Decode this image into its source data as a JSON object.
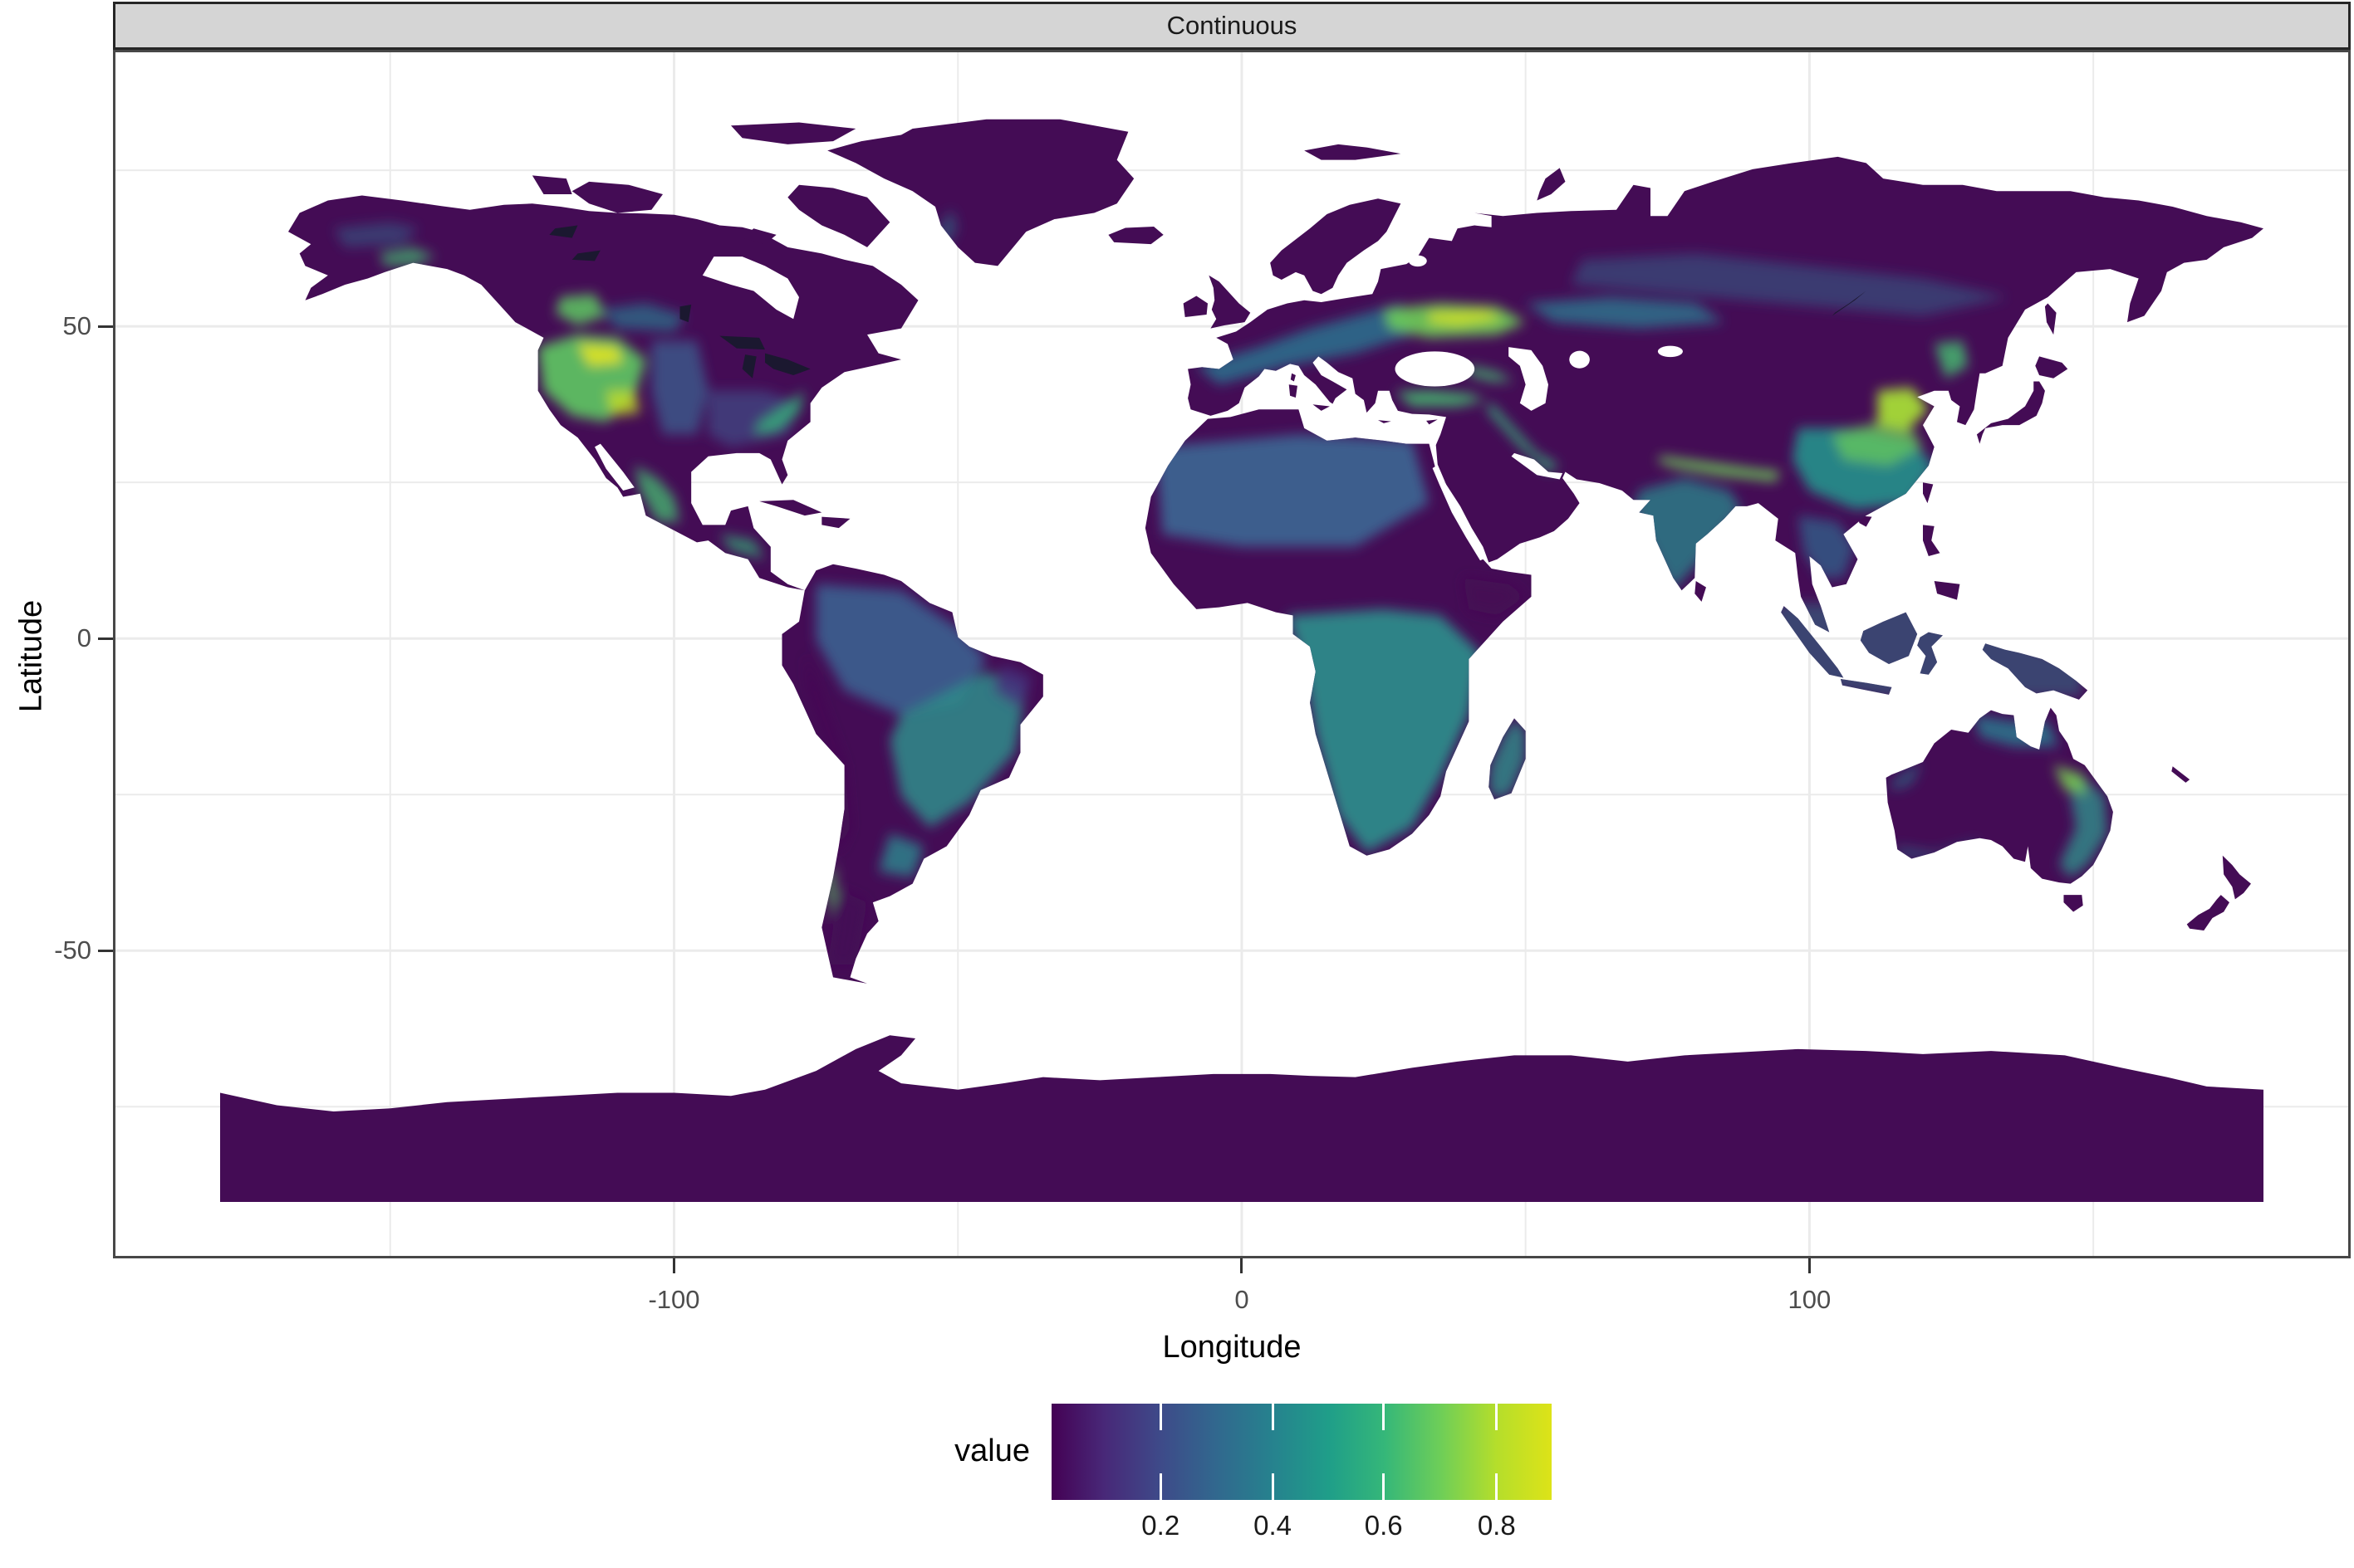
{
  "strip": {
    "title": "Continuous"
  },
  "axes": {
    "x": {
      "title": "Longitude",
      "breaks": [
        -100,
        0,
        100
      ],
      "labels": [
        "-100",
        "0",
        "100"
      ],
      "minor_breaks": [
        -150,
        -50,
        50,
        150
      ]
    },
    "y": {
      "title": "Latitude",
      "breaks": [
        50,
        0,
        -50
      ],
      "labels": [
        "50",
        "0",
        "-50"
      ],
      "minor_breaks": [
        75,
        25,
        -25,
        -75
      ]
    }
  },
  "legend": {
    "title": "value",
    "ticks": [
      "0.2",
      "0.4",
      "0.6",
      "0.8"
    ],
    "tick_fractions": [
      0.218,
      0.442,
      0.664,
      0.89
    ],
    "limits": [
      0.01,
      0.9
    ]
  },
  "colors": {
    "strip_bg": "#d5d5d5",
    "strip_border": "#262626",
    "panel_border": "#474747",
    "grid": "#ebebeb",
    "axis_text": "#4d4d4d",
    "text": "#000000",
    "land_low": "#440c55",
    "lake": "#1b1830",
    "viridis_stops": [
      [
        0.0,
        "#440154"
      ],
      [
        0.105,
        "#482878"
      ],
      [
        0.217,
        "#3e4a89"
      ],
      [
        0.33,
        "#31688e"
      ],
      [
        0.442,
        "#26828e"
      ],
      [
        0.554,
        "#1f9e89"
      ],
      [
        0.666,
        "#35b779"
      ],
      [
        0.778,
        "#6ece58"
      ],
      [
        0.89,
        "#b5de2b"
      ],
      [
        1.0,
        "#dde318"
      ]
    ]
  },
  "chart_data": {
    "type": "heatmap",
    "subtype": "global-raster-map",
    "title": "Continuous",
    "xlabel": "Longitude",
    "ylabel": "Latitude",
    "x_range": [
      -180,
      180
    ],
    "y_range": [
      -90,
      84
    ],
    "x_ticks": [
      -100,
      0,
      100
    ],
    "y_ticks": [
      -50,
      0,
      50
    ],
    "grid": true,
    "projection": "equirectangular",
    "legend": {
      "title": "value",
      "position": "bottom",
      "ticks": [
        0.2,
        0.4,
        0.6,
        0.8
      ],
      "limits_shown": [
        0.0,
        0.9
      ]
    },
    "palette": {
      "name": "viridis",
      "low": "#440154",
      "high": "#fde725"
    },
    "ocean": "no data (white)",
    "regions": [
      {
        "region": "Arctic Canada / boreal shield",
        "approx_value": 0.05
      },
      {
        "region": "Greenland",
        "approx_value": 0.05
      },
      {
        "region": "Antarctica",
        "approx_value": 0.05
      },
      {
        "region": "Western US mountain ranges (Rockies, Sierra, Cascades)",
        "approx_value": 0.75
      },
      {
        "region": "Idaho / Montana northern Rockies",
        "approx_value": 0.9
      },
      {
        "region": "Great Plains (US)",
        "approx_value": 0.3
      },
      {
        "region": "Eastern US lowlands",
        "approx_value": 0.3
      },
      {
        "region": "Appalachians",
        "approx_value": 0.6
      },
      {
        "region": "Sierra Madre (Mexico)",
        "approx_value": 0.6
      },
      {
        "region": "Amazon basin",
        "approx_value": 0.35
      },
      {
        "region": "Brazilian highlands / SE South America",
        "approx_value": 0.5
      },
      {
        "region": "Andes ridge",
        "approx_value": 0.1
      },
      {
        "region": "Patagonia",
        "approx_value": 0.1
      },
      {
        "region": "Sahara (northern Africa)",
        "approx_value": 0.3
      },
      {
        "region": "Sahel belt",
        "approx_value": 0.1
      },
      {
        "region": "Central & southern Africa",
        "approx_value": 0.5
      },
      {
        "region": "Horn of Africa",
        "approx_value": 0.1
      },
      {
        "region": "Western / central Europe",
        "approx_value": 0.45
      },
      {
        "region": "Ukraine / southern Russia belt",
        "approx_value": 0.85
      },
      {
        "region": "Anatolia (Turkey)",
        "approx_value": 0.7
      },
      {
        "region": "Caucasus and Zagros ridges",
        "approx_value": 0.7
      },
      {
        "region": "Central Asian steppe",
        "approx_value": 0.5
      },
      {
        "region": "Tibetan Plateau",
        "approx_value": 0.08
      },
      {
        "region": "Himalayan front",
        "approx_value": 0.7
      },
      {
        "region": "Indian peninsula",
        "approx_value": 0.5
      },
      {
        "region": "North China Plain",
        "approx_value": 0.85
      },
      {
        "region": "Southeast China",
        "approx_value": 0.6
      },
      {
        "region": "Japan",
        "approx_value": 0.1
      },
      {
        "region": "Maritime Southeast Asia",
        "approx_value": 0.4
      },
      {
        "region": "Northern Australia",
        "approx_value": 0.5
      },
      {
        "region": "Queensland interior patch",
        "approx_value": 0.7
      },
      {
        "region": "Australian interior",
        "approx_value": 0.08
      },
      {
        "region": "New Zealand South Island",
        "approx_value": 0.15
      }
    ]
  }
}
